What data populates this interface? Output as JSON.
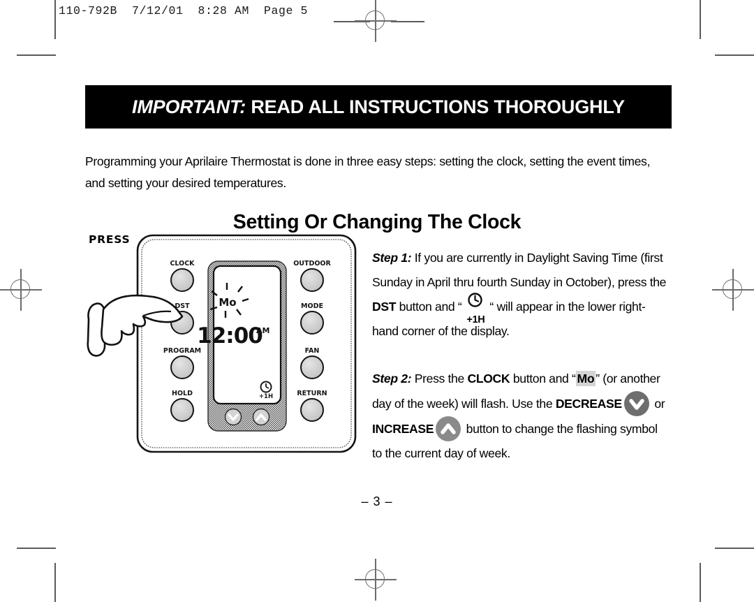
{
  "print_slug": "110-792B  7/12/01  8:28 AM  Page 5",
  "banner": {
    "emphasis": "IMPORTANT:",
    "rest": " READ ALL INSTRUCTIONS THOROUGHLY"
  },
  "intro": "Programming your Aprilaire Thermostat is done in three easy steps: setting the clock, setting the event times, and setting your desired temperatures.",
  "section_title": "Setting Or Changing The Clock",
  "steps": {
    "step1": {
      "label": "Step 1:",
      "text_a": " If you are currently in Daylight Saving Time (first Sunday in April thru fourth Sunday in October), press the ",
      "bold_a": "DST",
      "text_b": " button and “",
      "glyph_label": "+1H",
      "text_c": "“ will appear in the lower right-hand corner of the display."
    },
    "step2": {
      "label": "Step 2:",
      "text_a": " Press the ",
      "bold_a": "CLOCK",
      "text_b": " button and “",
      "highlight": "Mo",
      "text_c": "” (or another day of the week) will flash. Use the ",
      "bold_b": "DECREASE",
      "text_d": " or ",
      "bold_c": "INCREASE",
      "text_e": " button to change the flashing symbol to the current day of week."
    }
  },
  "illustration": {
    "press_label": "PRESS",
    "left_buttons": [
      "CLOCK",
      "DST",
      "PROGRAM",
      "HOLD"
    ],
    "right_buttons": [
      "OUTDOOR",
      "MODE",
      "FAN",
      "RETURN"
    ],
    "display": {
      "day": "Mo",
      "time": "12:00",
      "meridiem": "AM",
      "corner_indicator": "+1H"
    },
    "bottom_buttons": [
      "decrease-chevron",
      "increase-chevron"
    ]
  },
  "footer": {
    "page_number": "– 3 –"
  },
  "colors": {
    "banner_bg": "#000000",
    "banner_fg": "#ffffff",
    "highlight_bg": "#d4d4d4",
    "decrease_btn": "#6e6e6e",
    "increase_btn": "#8a8a8a",
    "crop_mark": "#5a5a5e"
  }
}
